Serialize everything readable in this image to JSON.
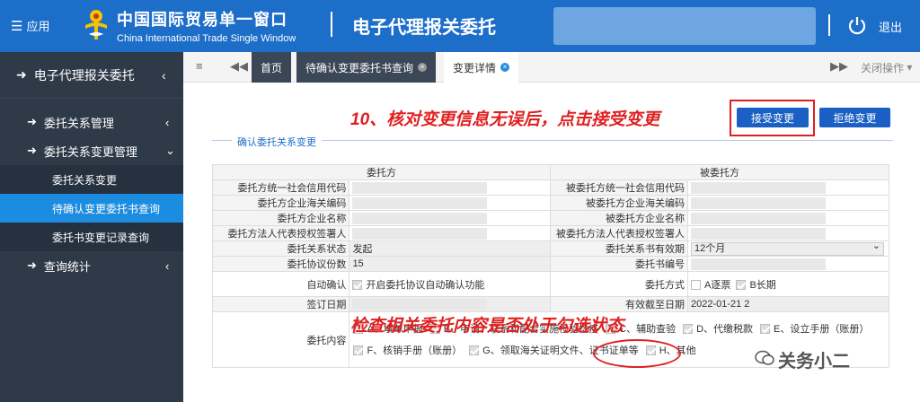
{
  "header": {
    "menu_label": "应用",
    "brand_cn": "中国国际贸易单一窗口",
    "brand_en": "China International Trade Single Window",
    "system_title": "电子代理报关委托",
    "logout_label": "退出"
  },
  "sidebar": {
    "title": "电子代理报关委托",
    "groups": [
      {
        "label": "委托关系管理"
      },
      {
        "label": "委托关系变更管理"
      }
    ],
    "sub_items": [
      {
        "label": "委托关系变更"
      },
      {
        "label": "待确认变更委托书查询"
      },
      {
        "label": "委托书变更记录查询"
      }
    ],
    "stats_label": "查询统计"
  },
  "tabs": {
    "items": [
      {
        "label": "首页"
      },
      {
        "label": "待确认变更委托书查询"
      },
      {
        "label": "变更详情"
      }
    ],
    "close_ops": "关闭操作"
  },
  "annotations": {
    "step": "10、核对变更信息无误后，点击接受变更",
    "check": "检查相关委托内容是否处于勾选状态"
  },
  "actions": {
    "accept": "接受变更",
    "reject": "拒绝变更"
  },
  "section_title": "确认委托关系变更",
  "form": {
    "col_left": "委托方",
    "col_right": "被委托方",
    "rows": [
      {
        "l": "委托方统一社会信用代码",
        "r": "被委托方统一社会信用代码"
      },
      {
        "l": "委托方企业海关编码",
        "r": "被委托方企业海关编码"
      },
      {
        "l": "委托方企业名称",
        "r": "被委托方企业名称"
      },
      {
        "l": "委托方法人代表授权签署人",
        "r": "被委托方法人代表授权签署人"
      }
    ],
    "status_label": "委托关系状态",
    "status_value": "发起",
    "validity_label": "委托关系书有效期",
    "validity_value": "12个月",
    "copies_label": "委托协议份数",
    "copies_value": "15",
    "doc_no_label": "委托书编号",
    "auto_label": "自动确认",
    "auto_value": "开启委托协议自动确认功能",
    "mode_label": "委托方式",
    "mode_a": "A逐票",
    "mode_b": "B长期",
    "sign_label": "签订日期",
    "expire_label": "有效截至日期",
    "expire_value": "2022-01-21 2",
    "content_label": "委托内容",
    "content_items_1": [
      "A、填单申报",
      "B、申请、联系和配合实施检验检疫",
      "C、辅助查验",
      "D、代缴税款",
      "E、设立手册（账册）"
    ],
    "content_items_2": [
      "F、核销手册（账册）",
      "G、领取海关证明文件、证书证单等",
      "H、其他"
    ]
  },
  "watermark": "关务小二",
  "colors": {
    "header": "#1c6ec9",
    "sidebar": "#2f3a48",
    "active": "#1c8ce0",
    "button": "#1a5fc4",
    "annotation": "#e02020"
  }
}
